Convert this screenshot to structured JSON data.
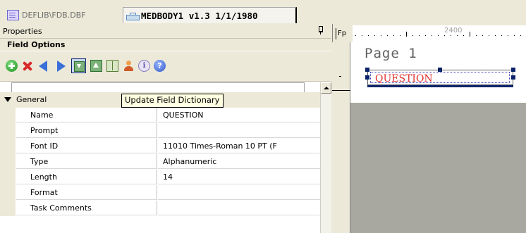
{
  "tabs": [
    {
      "label": "DEFLIB\\FDB.DBF",
      "icon": "table-icon",
      "active": false
    },
    {
      "label": "MEDBODY1 v1.3 1/1/1980",
      "icon": "layout-icon",
      "active": true
    }
  ],
  "properties": {
    "title": "Properties",
    "section_title": "Field Options",
    "toolbar_icons": [
      "add-icon",
      "delete-icon",
      "previous-icon",
      "next-icon",
      "update-field-dictionary-icon",
      "export-icon",
      "book-icon",
      "person-icon",
      "info-icon",
      "help-icon"
    ],
    "tooltip": "Update Field Dictionary",
    "group": "General",
    "rows": [
      {
        "name": "Name",
        "value": "QUESTION"
      },
      {
        "name": "Prompt",
        "value": ""
      },
      {
        "name": "Font ID",
        "value": "11010 Times-Roman 10 PT (F"
      },
      {
        "name": "Type",
        "value": "Alphanumeric"
      },
      {
        "name": "Length",
        "value": "14"
      },
      {
        "name": "Format",
        "value": ""
      },
      {
        "name": "Task Comments",
        "value": ""
      }
    ]
  },
  "designer": {
    "fp_label": "Fp",
    "ruler_number": "2400",
    "page_title": "Page 1",
    "field_text": "QUESTION"
  },
  "colors": {
    "panel_bg": "#ece9d8",
    "canvas_gray": "#a8a8a0",
    "field_text": "#e03030",
    "selection": "#0a246a",
    "tooltip_bg": "#ffffe1"
  }
}
